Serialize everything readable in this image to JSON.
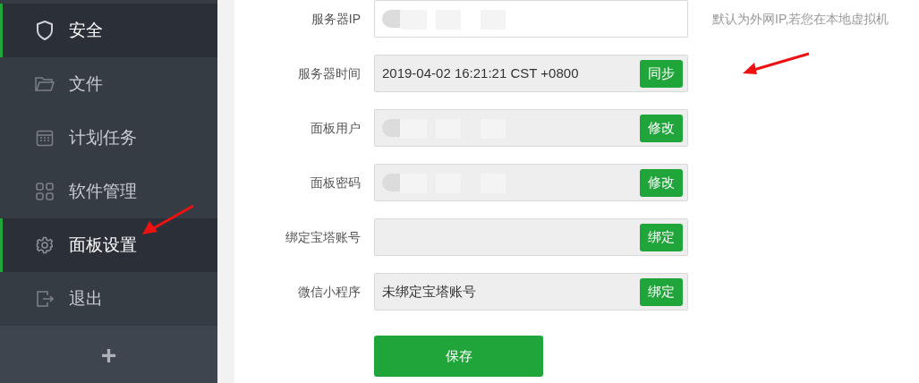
{
  "sidebar": {
    "items": [
      {
        "label": "安全",
        "selected": true
      },
      {
        "label": "文件",
        "selected": false
      },
      {
        "label": "计划任务",
        "selected": false
      },
      {
        "label": "软件管理",
        "selected": false
      },
      {
        "label": "面板设置",
        "selected": true
      },
      {
        "label": "退出",
        "selected": false
      }
    ],
    "add_button": "+"
  },
  "form": {
    "rows": [
      {
        "label": "服务器IP",
        "disabled": false,
        "redacted": true,
        "hint": "默认为外网IP,若您在本地虚拟机"
      },
      {
        "label": "服务器时间",
        "disabled": true,
        "value": "2019-04-02 16:21:21 CST +0800",
        "button": "同步",
        "arrow": true
      },
      {
        "label": "面板用户",
        "disabled": true,
        "redacted": true,
        "button": "修改"
      },
      {
        "label": "面板密码",
        "disabled": true,
        "redacted": true,
        "button": "修改"
      },
      {
        "label": "绑定宝塔账号",
        "disabled": true,
        "button": "绑定"
      },
      {
        "label": "微信小程序",
        "disabled": true,
        "value": "未绑定宝塔账号",
        "button": "绑定"
      }
    ],
    "save_button": "保存"
  }
}
